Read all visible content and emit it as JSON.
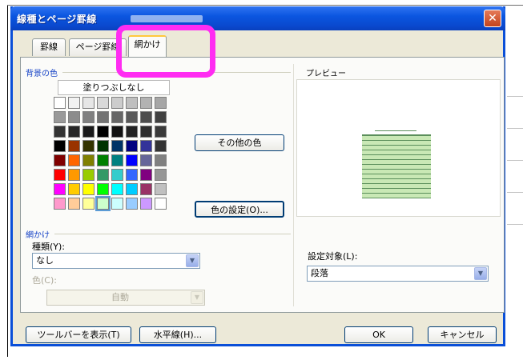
{
  "window": {
    "title": "線種とページ罫線",
    "close_symbol": "✕"
  },
  "tabs": [
    {
      "label": "罫線",
      "active": false
    },
    {
      "label": "ページ罫線",
      "active": false
    },
    {
      "label": "網かけ",
      "active": true
    }
  ],
  "fill": {
    "section_label": "背景の色",
    "no_color_label": "塗りつぶしなし",
    "more_colors_label": "その他の色",
    "color_settings_label": "色の設定(O)...",
    "swatches": [
      "#ffffff",
      "#f2f2f2",
      "#e6e6e6",
      "#d9d9d9",
      "#cccccc",
      "#bfbfbf",
      "#b2b2b2",
      "#a6a6a6",
      "#999999",
      "#8c8c8c",
      "#808080",
      "#737373",
      "#666666",
      "#595959",
      "#4d4d4d",
      "#404040",
      "#333333",
      "#262626",
      "#1a1a1a",
      "#000000",
      "#111111",
      "#222222",
      "#2e2e2e",
      "#3a3a3a",
      "#000000",
      "#993300",
      "#333300",
      "#003300",
      "#003366",
      "#000080",
      "#333399",
      "#333333",
      "#800000",
      "#ff6600",
      "#808000",
      "#008000",
      "#008080",
      "#0000ff",
      "#666699",
      "#808080",
      "#ff0000",
      "#ff9900",
      "#99cc00",
      "#339966",
      "#33cccc",
      "#3366ff",
      "#800080",
      "#969696",
      "#ff00ff",
      "#ffcc00",
      "#ffff00",
      "#00ff00",
      "#00ffff",
      "#00ccff",
      "#993366",
      "#c0c0c0",
      "#ff99cc",
      "#ffcc99",
      "#ffff99",
      "#ccffcc",
      "#ccffff",
      "#99ccff",
      "#cc99ff",
      "#ffffff"
    ],
    "selected_swatch": 59
  },
  "pattern": {
    "section_label": "網かけ",
    "style_label": "種類(Y):",
    "style_value": "なし",
    "color_label": "色(C):",
    "color_value": "自動"
  },
  "preview": {
    "label": "プレビュー",
    "apply_to_label": "設定対象(L):",
    "apply_to_value": "段落"
  },
  "footer": {
    "toolbar_button": "ツールバーを表示(T)",
    "horizontal_line_button": "水平線(H)...",
    "ok_button": "OK",
    "cancel_button": "キャンセル"
  }
}
